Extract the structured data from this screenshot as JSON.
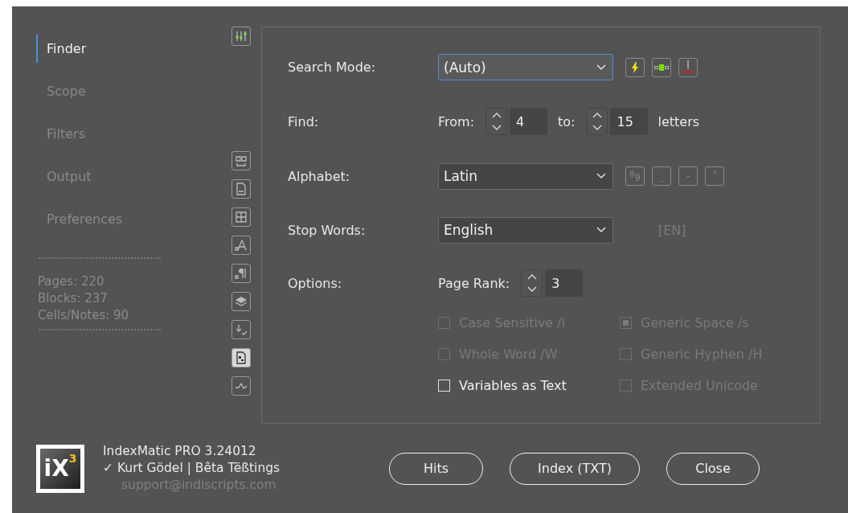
{
  "sidebar": {
    "items": [
      {
        "label": "Finder",
        "selected": true
      },
      {
        "label": "Scope",
        "selected": false
      },
      {
        "label": "Filters",
        "selected": false
      },
      {
        "label": "Output",
        "selected": false
      },
      {
        "label": "Preferences",
        "selected": false
      }
    ],
    "stats": [
      "Pages: 220",
      "Blocks: 237",
      "Cells/Notes: 90"
    ],
    "tools": [
      {
        "kind": "sliders",
        "selected": false
      },
      {
        "kind": "book",
        "selected": false
      },
      {
        "kind": "page",
        "selected": false
      },
      {
        "kind": "table",
        "selected": false
      },
      {
        "kind": "char",
        "selected": false
      },
      {
        "kind": "para",
        "selected": false
      },
      {
        "kind": "layers",
        "selected": false
      },
      {
        "kind": "download",
        "selected": false
      },
      {
        "kind": "doc",
        "selected": true
      },
      {
        "kind": "graph",
        "selected": false
      }
    ]
  },
  "finder": {
    "search_mode": {
      "label": "Search Mode:",
      "value": "(Auto)",
      "focused": true,
      "tools": [
        {
          "kind": "bolt"
        },
        {
          "kind": "link"
        },
        {
          "kind": "fork"
        }
      ]
    },
    "find": {
      "label": "Find:",
      "from_label": "From:",
      "from": "4",
      "to_label": "to:",
      "to": "15",
      "unit": "letters"
    },
    "alphabet": {
      "label": "Alphabet:",
      "value": "Latin",
      "keys": [
        "$^{0}$9",
        "_",
        "-",
        "’"
      ]
    },
    "stop_words": {
      "label": "Stop Words:",
      "value": "English",
      "code": "[EN]"
    },
    "options": {
      "label": "Options:",
      "rank_label": "Page Rank:",
      "rank": "3",
      "checks": [
        {
          "label": "Case Sensitive /i",
          "checked": false,
          "disabled": true
        },
        {
          "label": "Generic Space /s",
          "checked": true,
          "disabled": true
        },
        {
          "label": "Whole Word /W",
          "checked": false,
          "disabled": true
        },
        {
          "label": "Generic Hyphen /H",
          "checked": false,
          "disabled": true
        },
        {
          "label": "Variables as Text",
          "checked": false,
          "disabled": false
        },
        {
          "label": "Extended Unicode",
          "checked": false,
          "disabled": true
        }
      ]
    }
  },
  "footer": {
    "logo": {
      "text": "iX",
      "sup": "3"
    },
    "product": "IndexMatic PRO 3.24012",
    "check": "✓",
    "license": "Kurt Gödel | Bêta Tëßtings",
    "email": "support@indiscripts.com",
    "buttons": [
      "Hits",
      "Index (TXT)",
      "Close"
    ]
  }
}
